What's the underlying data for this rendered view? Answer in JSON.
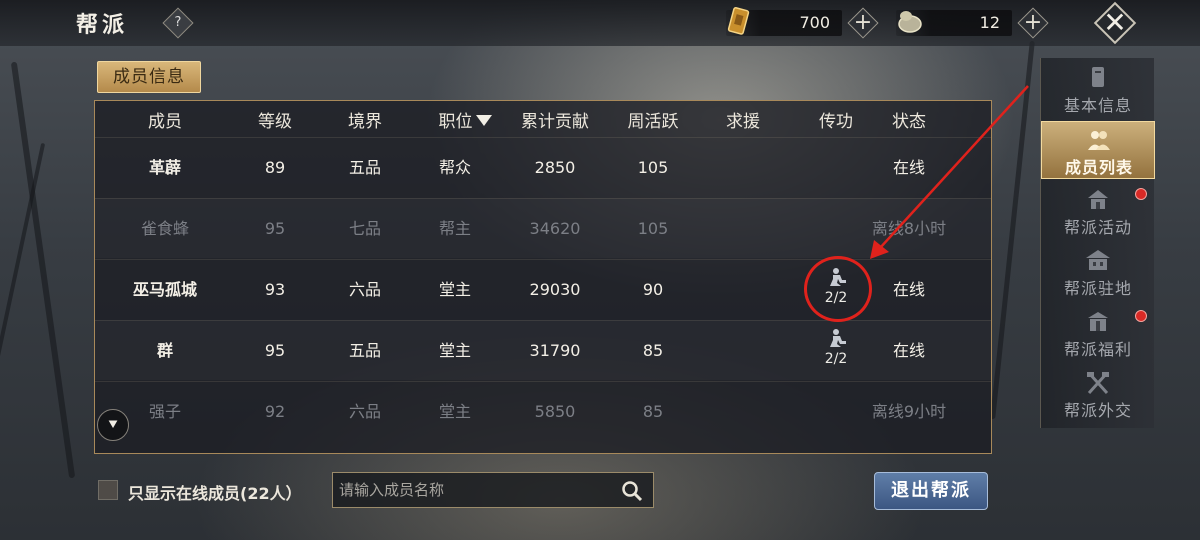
{
  "header": {
    "title": "帮派",
    "help_glyph": "?"
  },
  "resources": [
    {
      "name": "scroll-currency-icon",
      "value": "700",
      "color": "#d9a441"
    },
    {
      "name": "jade-currency-icon",
      "value": "12",
      "color": "#c9c2a3"
    }
  ],
  "close_glyph": "✕",
  "add_glyph": "+",
  "section_tab": "成员信息",
  "table": {
    "columns": [
      "成员",
      "等级",
      "境界",
      "职位",
      "累计贡献",
      "周活跃",
      "求援",
      "传功",
      "状态"
    ],
    "rows": [
      {
        "name": "革薜",
        "level": "89",
        "realm": "五品",
        "position": "帮众",
        "contribution": "2850",
        "weekly": "105",
        "teach": "",
        "status": "在线",
        "online": true
      },
      {
        "name": "雀食蜂",
        "level": "95",
        "realm": "七品",
        "position": "帮主",
        "contribution": "34620",
        "weekly": "105",
        "teach": "",
        "status": "离线8小时",
        "online": false
      },
      {
        "name": "巫马孤城",
        "level": "93",
        "realm": "六品",
        "position": "堂主",
        "contribution": "29030",
        "weekly": "90",
        "teach": "2/2",
        "status": "在线",
        "online": true
      },
      {
        "name": "群",
        "level": "95",
        "realm": "五品",
        "position": "堂主",
        "contribution": "31790",
        "weekly": "85",
        "teach": "2/2",
        "status": "在线",
        "online": true
      },
      {
        "name": "强子",
        "level": "92",
        "realm": "六品",
        "position": "堂主",
        "contribution": "5850",
        "weekly": "85",
        "teach": "",
        "status": "离线9小时",
        "online": false
      }
    ]
  },
  "sidebar": {
    "items": [
      {
        "label": "基本信息",
        "icon": "info-icon",
        "active": false,
        "badge": false
      },
      {
        "label": "成员列表",
        "icon": "members-icon",
        "active": true,
        "badge": false
      },
      {
        "label": "帮派活动",
        "icon": "activity-icon",
        "active": false,
        "badge": true
      },
      {
        "label": "帮派驻地",
        "icon": "residence-icon",
        "active": false,
        "badge": false
      },
      {
        "label": "帮派福利",
        "icon": "welfare-icon",
        "active": false,
        "badge": true
      },
      {
        "label": "帮派外交",
        "icon": "diplomacy-icon",
        "active": false,
        "badge": false
      }
    ]
  },
  "filter": {
    "label": "只显示在线成员(22人）",
    "checked": false
  },
  "search": {
    "placeholder": "请输入成员名称",
    "value": ""
  },
  "exit_button": "退出帮派",
  "scroll_glyph": "⯆",
  "colors": {
    "accent_gold": "#b48a4b",
    "highlight_red": "#e0221c",
    "exit_blue": "#4a6896"
  }
}
